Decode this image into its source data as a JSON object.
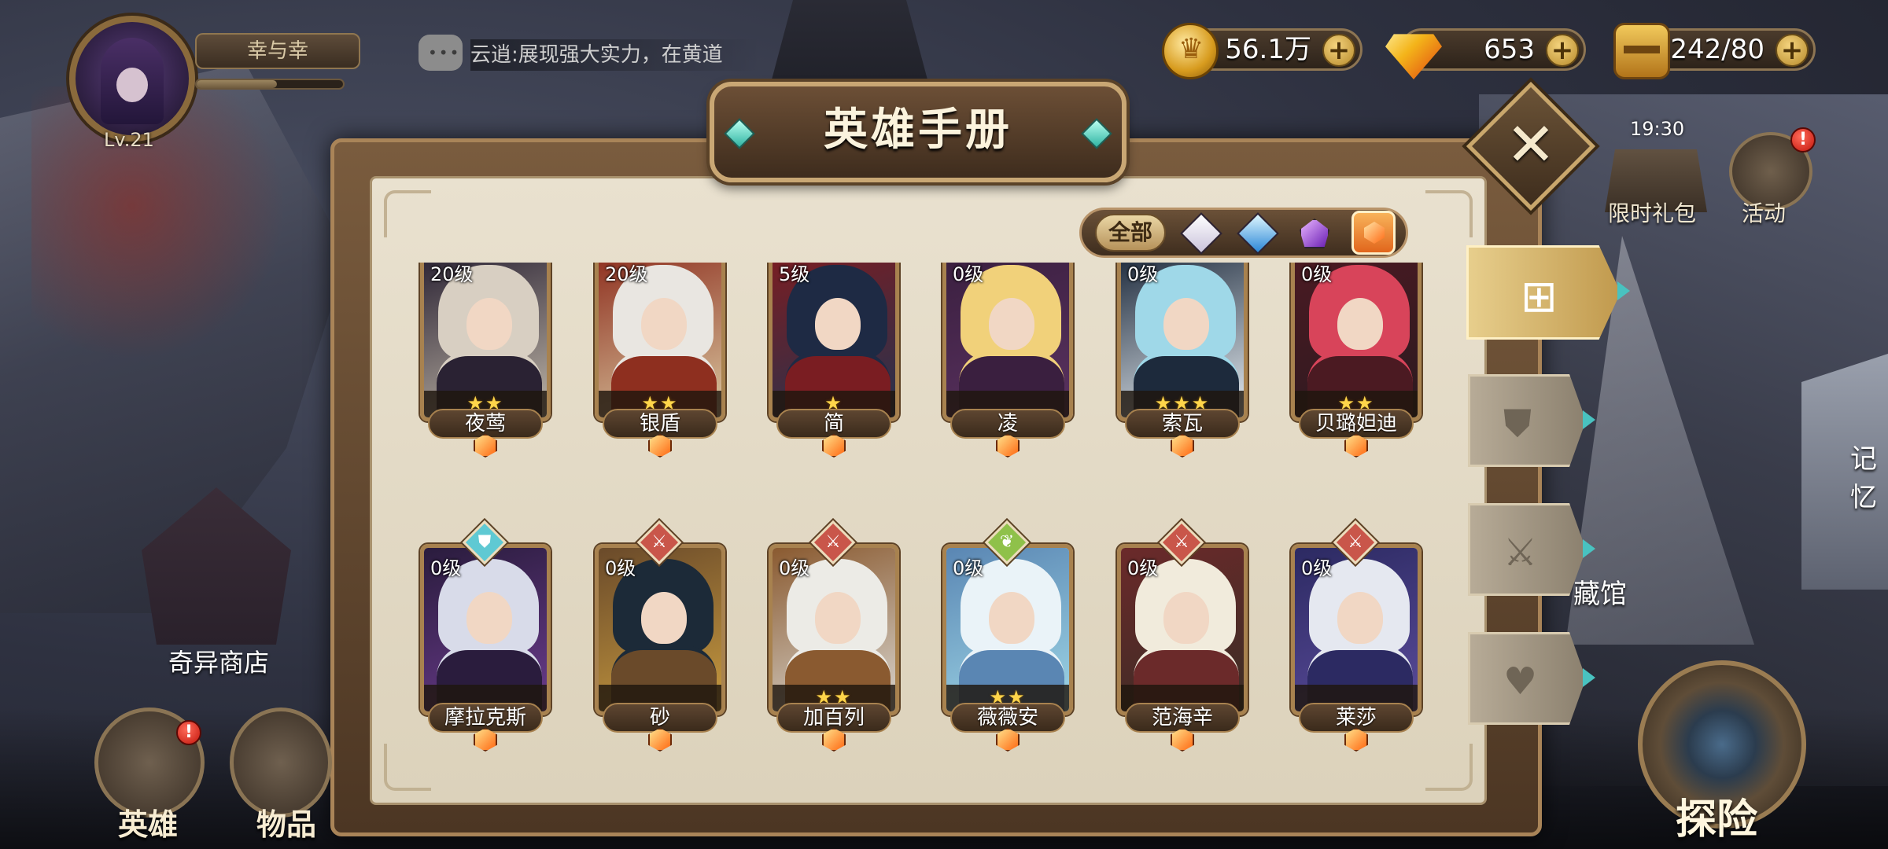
{
  "player": {
    "name": "幸与幸",
    "level": "Lv.21",
    "exp_fraction": 0.55
  },
  "chat": {
    "message": "云逍:展现强大实力，在黄道"
  },
  "resources": {
    "gold": {
      "amount": "56.1万",
      "plus": "+"
    },
    "diamond": {
      "amount": "653",
      "plus": "+"
    },
    "stamina": {
      "amount": "242/80",
      "plus": "+"
    }
  },
  "side_buttons": {
    "gift": {
      "label": "限时礼包",
      "timer": "19:30"
    },
    "activity": {
      "label": "活动",
      "badge": "!"
    }
  },
  "close": {
    "label": "✕"
  },
  "panel": {
    "title": "英雄手册"
  },
  "filters": {
    "all_label": "全部",
    "options": [
      "white-gem",
      "blue-gem",
      "purple-gem",
      "orange-gem"
    ],
    "active": "all"
  },
  "heroes_row1": [
    {
      "name": "夜莺",
      "level": "20级",
      "stars": "★★",
      "palette": [
        "#d8cfc2",
        "#2a2233",
        "#bfb6a7"
      ]
    },
    {
      "name": "银盾",
      "level": "20级",
      "stars": "★★",
      "palette": [
        "#e9e6e1",
        "#8e2f1f",
        "#d9c7a0"
      ]
    },
    {
      "name": "简",
      "level": "5级",
      "stars": "★",
      "palette": [
        "#1e2a44",
        "#7a1d22",
        "#25334f"
      ]
    },
    {
      "name": "凌",
      "level": "0级",
      "stars": "",
      "palette": [
        "#f1d17a",
        "#3a1f3f",
        "#5a3260"
      ]
    },
    {
      "name": "索瓦",
      "level": "0级",
      "stars": "★★★",
      "palette": [
        "#9fd8e8",
        "#1d2a3c",
        "#e6edf2"
      ]
    },
    {
      "name": "贝璐妲迪",
      "level": "0级",
      "stars": "★★",
      "palette": [
        "#d8445a",
        "#4b1a22",
        "#2c1a20"
      ]
    }
  ],
  "heroes_row2": [
    {
      "name": "摩拉克斯",
      "level": "0级",
      "stars": "",
      "class_icon": "shield",
      "class_color": "#5fc9d3",
      "palette": [
        "#d8dbe9",
        "#2a1c3d",
        "#6a3b8c"
      ]
    },
    {
      "name": "砂",
      "level": "0级",
      "stars": "",
      "class_icon": "sword",
      "class_color": "#c9564a",
      "palette": [
        "#1c2a38",
        "#6a4a2a",
        "#c79a3f"
      ]
    },
    {
      "name": "加百列",
      "level": "0级",
      "stars": "★★",
      "class_icon": "sword",
      "class_color": "#c9564a",
      "palette": [
        "#ecebe6",
        "#8a5a30",
        "#d9d6cf"
      ]
    },
    {
      "name": "薇薇安",
      "level": "0级",
      "stars": "★★",
      "class_icon": "leaf",
      "class_color": "#8fc14a",
      "palette": [
        "#eaf3f8",
        "#5a86b3",
        "#9ed6e6"
      ]
    },
    {
      "name": "范海辛",
      "level": "0级",
      "stars": "",
      "class_icon": "sword",
      "class_color": "#c9564a",
      "palette": [
        "#f1ebdc",
        "#6b2a2a",
        "#3a2c25"
      ]
    },
    {
      "name": "莱莎",
      "level": "0级",
      "stars": "",
      "class_icon": "sword",
      "class_color": "#c9564a",
      "palette": [
        "#e5e8f0",
        "#2c2a62",
        "#5a4b9a"
      ]
    }
  ],
  "tabs": [
    {
      "name": "all",
      "icon": "⊞"
    },
    {
      "name": "tank",
      "icon": "⛊"
    },
    {
      "name": "warrior",
      "icon": "⚔"
    },
    {
      "name": "support",
      "icon": "♥"
    }
  ],
  "bottom_nav": {
    "heroes": {
      "label": "英雄",
      "badge": "!"
    },
    "items": {
      "label": "物品"
    },
    "explore": {
      "label": "探险"
    }
  },
  "scene_labels": {
    "shop": "奇异商店",
    "museum_partial": "藏馆",
    "memory_partial": "记忆"
  },
  "colors": {
    "panel_bg": "#e6dece",
    "gold_trim": "#c9a774",
    "teal_arrow": "#49c2c0",
    "star": "#ffd54a"
  }
}
